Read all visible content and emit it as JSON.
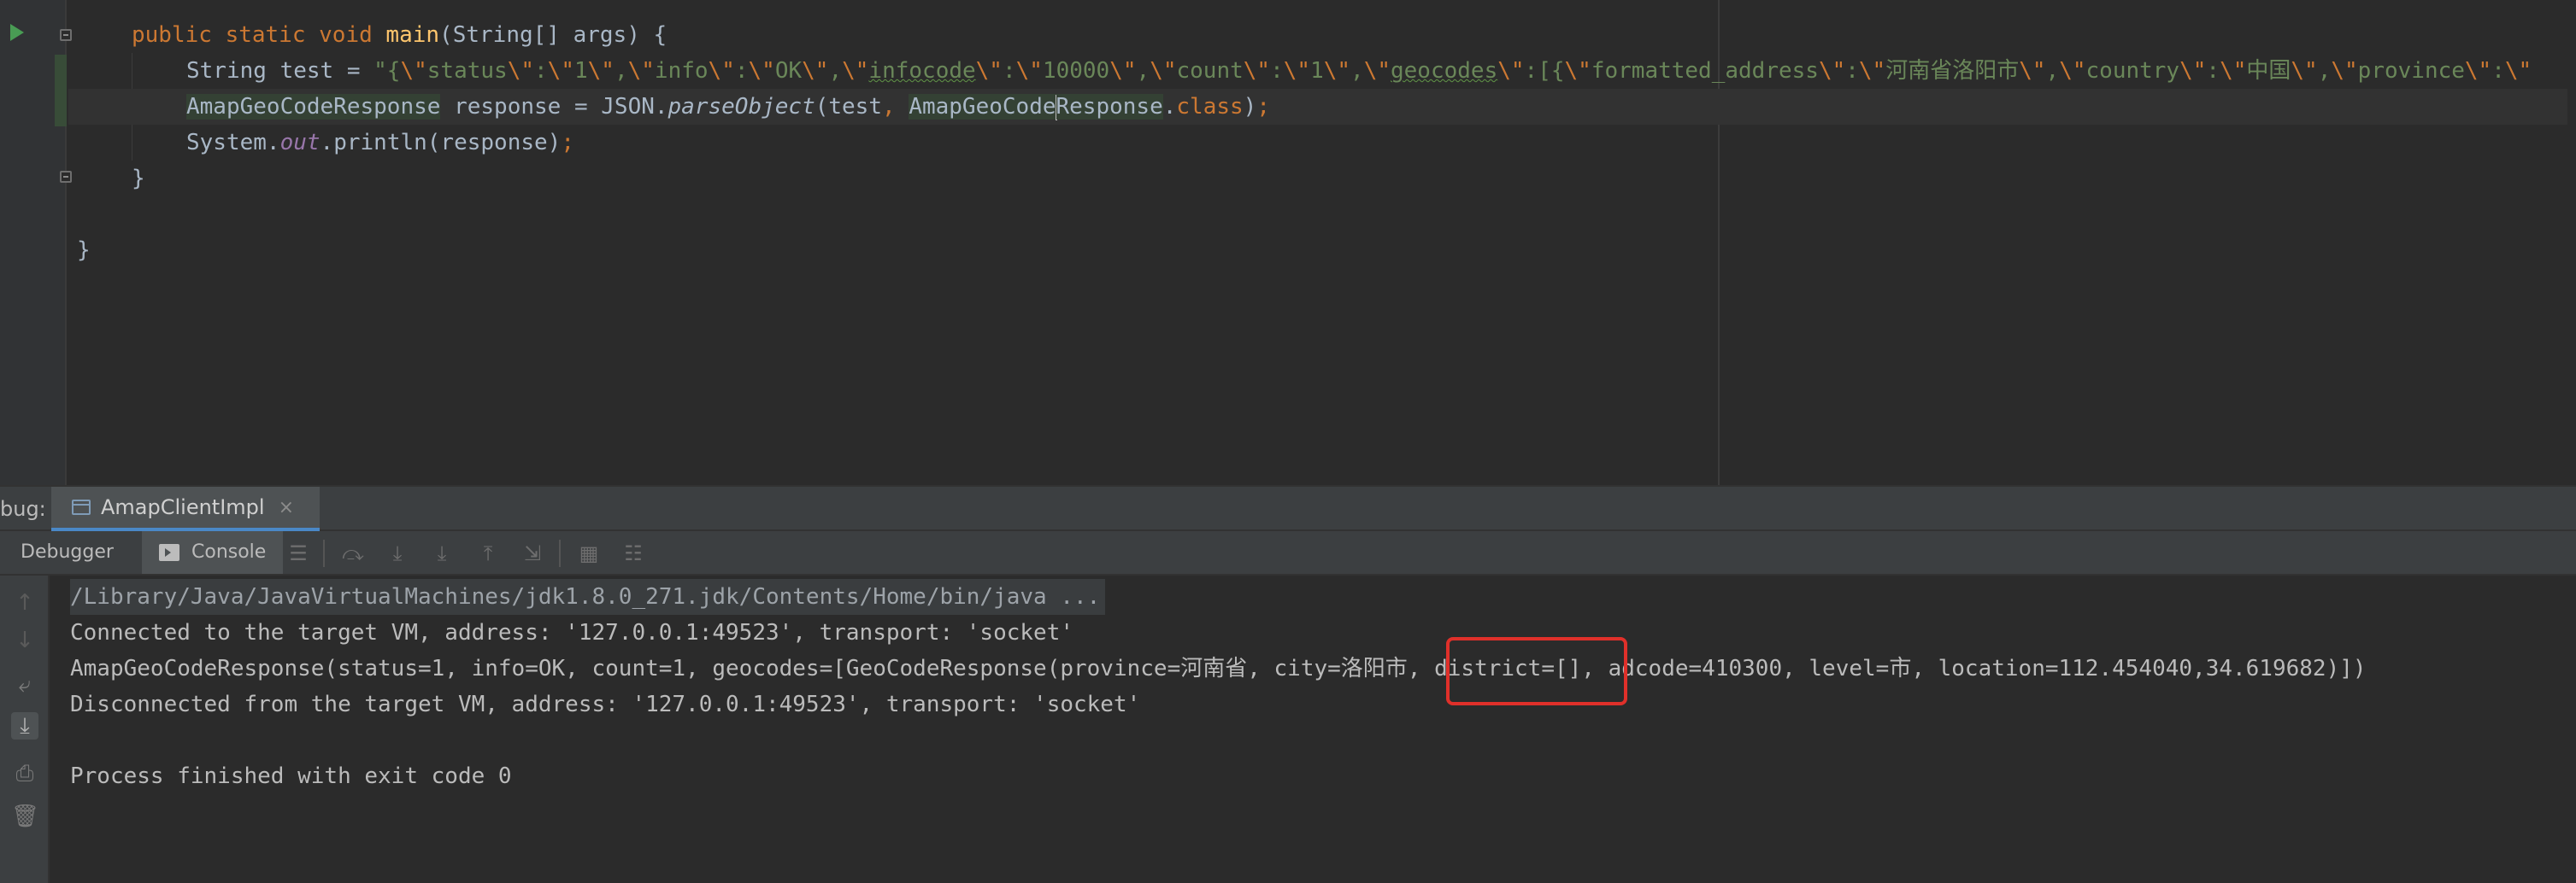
{
  "editor": {
    "lines": [
      {
        "tokens": [
          {
            "t": "public static void ",
            "c": "kw"
          },
          {
            "t": "main",
            "c": "fn"
          },
          {
            "t": "(String[] args) {",
            "c": ""
          }
        ]
      },
      {
        "tokens": [
          {
            "t": "String test = ",
            "c": ""
          },
          {
            "t": "\"{",
            "c": "str"
          },
          {
            "t": "\\\"",
            "c": "esc"
          },
          {
            "t": "status",
            "c": "str"
          },
          {
            "t": "\\\"",
            "c": "esc"
          },
          {
            "t": ":",
            "c": "str"
          },
          {
            "t": "\\\"",
            "c": "esc"
          },
          {
            "t": "1",
            "c": "str"
          },
          {
            "t": "\\\"",
            "c": "esc"
          },
          {
            "t": ",",
            "c": "str"
          },
          {
            "t": "\\\"",
            "c": "esc"
          },
          {
            "t": "info",
            "c": "str"
          },
          {
            "t": "\\\"",
            "c": "esc"
          },
          {
            "t": ":",
            "c": "str"
          },
          {
            "t": "\\\"",
            "c": "esc"
          },
          {
            "t": "OK",
            "c": "str"
          },
          {
            "t": "\\\"",
            "c": "esc"
          },
          {
            "t": ",",
            "c": "str"
          },
          {
            "t": "\\\"",
            "c": "esc"
          },
          {
            "t": "infocode",
            "c": "str typo"
          },
          {
            "t": "\\\"",
            "c": "esc"
          },
          {
            "t": ":",
            "c": "str"
          },
          {
            "t": "\\\"",
            "c": "esc"
          },
          {
            "t": "10000",
            "c": "str"
          },
          {
            "t": "\\\"",
            "c": "esc"
          },
          {
            "t": ",",
            "c": "str"
          },
          {
            "t": "\\\"",
            "c": "esc"
          },
          {
            "t": "count",
            "c": "str"
          },
          {
            "t": "\\\"",
            "c": "esc"
          },
          {
            "t": ":",
            "c": "str"
          },
          {
            "t": "\\\"",
            "c": "esc"
          },
          {
            "t": "1",
            "c": "str"
          },
          {
            "t": "\\\"",
            "c": "esc"
          },
          {
            "t": ",",
            "c": "str"
          },
          {
            "t": "\\\"",
            "c": "esc"
          },
          {
            "t": "geocodes",
            "c": "str typo"
          },
          {
            "t": "\\\"",
            "c": "esc"
          },
          {
            "t": ":[{",
            "c": "str"
          },
          {
            "t": "\\\"",
            "c": "esc"
          },
          {
            "t": "formatted_address",
            "c": "str"
          },
          {
            "t": "\\\"",
            "c": "esc"
          },
          {
            "t": ":",
            "c": "str"
          },
          {
            "t": "\\\"",
            "c": "esc"
          },
          {
            "t": "河南省洛阳市",
            "c": "str"
          },
          {
            "t": "\\\"",
            "c": "esc"
          },
          {
            "t": ",",
            "c": "str"
          },
          {
            "t": "\\\"",
            "c": "esc"
          },
          {
            "t": "country",
            "c": "str"
          },
          {
            "t": "\\\"",
            "c": "esc"
          },
          {
            "t": ":",
            "c": "str"
          },
          {
            "t": "\\\"",
            "c": "esc"
          },
          {
            "t": "中国",
            "c": "str"
          },
          {
            "t": "\\\"",
            "c": "esc"
          },
          {
            "t": ",",
            "c": "str"
          },
          {
            "t": "\\\"",
            "c": "esc"
          },
          {
            "t": "province",
            "c": "str"
          },
          {
            "t": "\\\"",
            "c": "esc"
          },
          {
            "t": ":",
            "c": "str"
          },
          {
            "t": "\\\"",
            "c": "esc"
          }
        ]
      },
      {
        "current": true,
        "tokens": [
          {
            "t": "AmapGeoCodeResponse",
            "c": "hl-usage"
          },
          {
            "t": " response = JSON.",
            "c": ""
          },
          {
            "t": "parseObject",
            "c": "italic"
          },
          {
            "t": "(test",
            "c": ""
          },
          {
            "t": ", ",
            "c": "kw"
          },
          {
            "t": "AmapGeoCode",
            "c": "hl-usage"
          },
          {
            "t": "|",
            "c": "caret"
          },
          {
            "t": "Response",
            "c": "hl-usage"
          },
          {
            "t": ".",
            "c": ""
          },
          {
            "t": "class",
            "c": "kw"
          },
          {
            "t": ")",
            "c": ""
          },
          {
            "t": ";",
            "c": "kw"
          }
        ]
      },
      {
        "tokens": [
          {
            "t": "System.",
            "c": ""
          },
          {
            "t": "out",
            "c": "static-field"
          },
          {
            "t": ".println(response)",
            "c": ""
          },
          {
            "t": ";",
            "c": "kw"
          }
        ]
      },
      {
        "tokens": [
          {
            "t": "}",
            "c": ""
          }
        ]
      },
      {
        "tokens": [
          {
            "t": "",
            "c": ""
          }
        ]
      },
      {
        "tokens": [
          {
            "t": "}",
            "c": ""
          }
        ]
      }
    ]
  },
  "debug": {
    "label": "bug:",
    "tab_name": "AmapClientImpl",
    "tab_close": "×",
    "subtabs": {
      "debugger": "Debugger",
      "console": "Console"
    }
  },
  "console": {
    "lines": [
      "/Library/Java/JavaVirtualMachines/jdk1.8.0_271.jdk/Contents/Home/bin/java ...",
      "Connected to the target VM, address: '127.0.0.1:49523', transport: 'socket'",
      "AmapGeoCodeResponse(status=1, info=OK, count=1, geocodes=[GeoCodeResponse(province=河南省, city=洛阳市, district=[], adcode=410300, level=市, location=112.454040,34.619682)])",
      "Disconnected from the target VM, address: '127.0.0.1:49523', transport: 'socket'",
      "",
      "Process finished with exit code 0"
    ]
  },
  "icons": {
    "toolbar": [
      "menu-icon",
      "step-over-icon",
      "step-into-icon",
      "force-step-into-icon",
      "step-out-icon",
      "run-to-cursor-icon",
      "evaluate-icon",
      "trace-icon"
    ],
    "side": [
      "up-arrow-icon",
      "down-arrow-icon",
      "soft-wrap-icon",
      "scroll-to-end-icon",
      "print-icon",
      "trash-icon"
    ]
  },
  "colors": {
    "highlight_box": "#e0302a",
    "tab_underline": "#4a88c7"
  }
}
